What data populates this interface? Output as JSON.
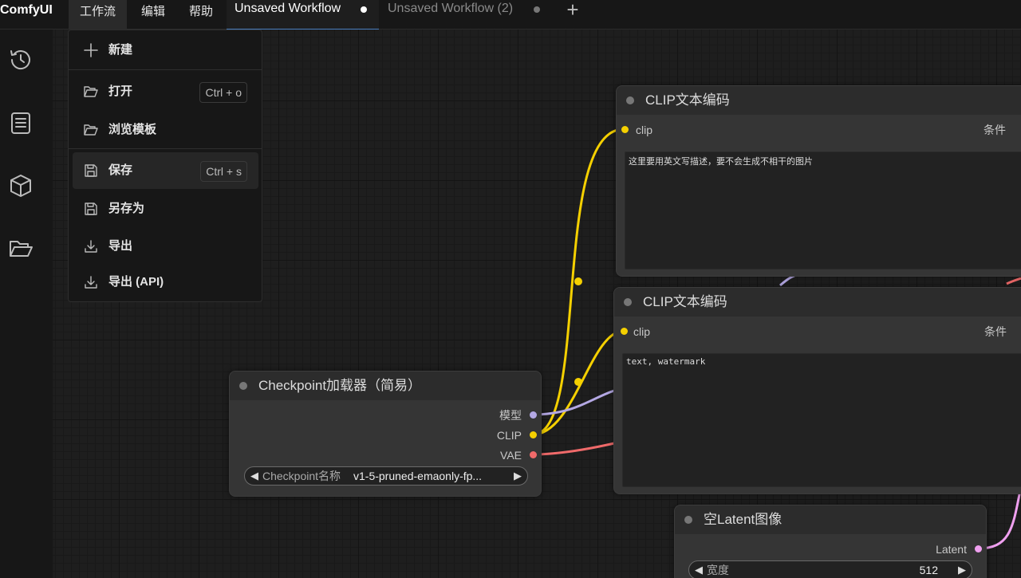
{
  "app": {
    "title": "ComfyUI"
  },
  "menubar": {
    "workflow": "工作流",
    "edit": "编辑",
    "help": "帮助"
  },
  "tabs": [
    {
      "label": "Unsaved Workflow",
      "active": true
    },
    {
      "label": "Unsaved Workflow (2)",
      "active": false
    }
  ],
  "sidebar": {
    "items": [
      {
        "icon": "history-icon"
      },
      {
        "icon": "document-list-icon"
      },
      {
        "icon": "cube-icon"
      },
      {
        "icon": "folder-open-icon"
      }
    ]
  },
  "workflow_menu": {
    "items": [
      {
        "label": "新建",
        "icon": "plus-icon"
      },
      {
        "label": "打开",
        "icon": "folder-open-icon",
        "shortcut": "Ctrl + o"
      },
      {
        "label": "浏览模板",
        "icon": "folder-open-icon"
      },
      {
        "label": "保存",
        "icon": "save-icon",
        "shortcut": "Ctrl + s"
      },
      {
        "label": "另存为",
        "icon": "save-icon"
      },
      {
        "label": "导出",
        "icon": "download-icon"
      },
      {
        "label": "导出 (API)",
        "icon": "download-icon"
      }
    ]
  },
  "nodes": {
    "clip_positive": {
      "title": "CLIP文本编码",
      "input": "clip",
      "output": "条件",
      "text": "这里要用英文写描述，要不会生成不相干的图片"
    },
    "clip_negative": {
      "title": "CLIP文本编码",
      "input": "clip",
      "output": "条件",
      "text": "text, watermark"
    },
    "checkpoint": {
      "title": "Checkpoint加载器（简易）",
      "outputs": [
        "模型",
        "CLIP",
        "VAE"
      ],
      "widget_label": "Checkpoint名称",
      "widget_value": "v1-5-pruned-emaonly-fp..."
    },
    "empty_latent": {
      "title": "空Latent图像",
      "output": "Latent",
      "widget_label": "宽度",
      "widget_value": "512"
    }
  },
  "colors": {
    "clip": "#f5d000",
    "model": "#b4a8e4",
    "vae": "#f06a6a",
    "latent": "#f0a0f0",
    "accent_tab": "#4a7fc0"
  }
}
